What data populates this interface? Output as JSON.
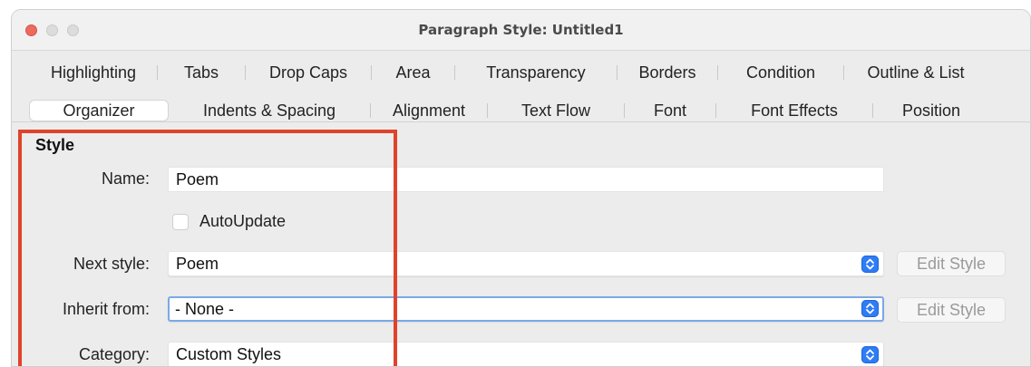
{
  "window": {
    "title": "Paragraph Style: Untitled1"
  },
  "tabs": {
    "row1": [
      "Highlighting",
      "Tabs",
      "Drop Caps",
      "Area",
      "Transparency",
      "Borders",
      "Condition",
      "Outline & List"
    ],
    "row2": [
      "Organizer",
      "Indents & Spacing",
      "Alignment",
      "Text Flow",
      "Font",
      "Font Effects",
      "Position"
    ],
    "selected": "Organizer"
  },
  "style_section": {
    "title": "Style",
    "name_label": "Name:",
    "name_value": "Poem",
    "autoupdate_label": "AutoUpdate",
    "autoupdate_checked": false,
    "next_style_label": "Next style:",
    "next_style_value": "Poem",
    "inherit_from_label": "Inherit from:",
    "inherit_from_value": "- None -",
    "category_label": "Category:",
    "category_value": "Custom Styles",
    "edit_style_label": "Edit Style"
  },
  "colors": {
    "highlight_box": "#e0432b",
    "stepper_accent": "#2e7cf6",
    "focus_ring": "#7aa8e8"
  }
}
